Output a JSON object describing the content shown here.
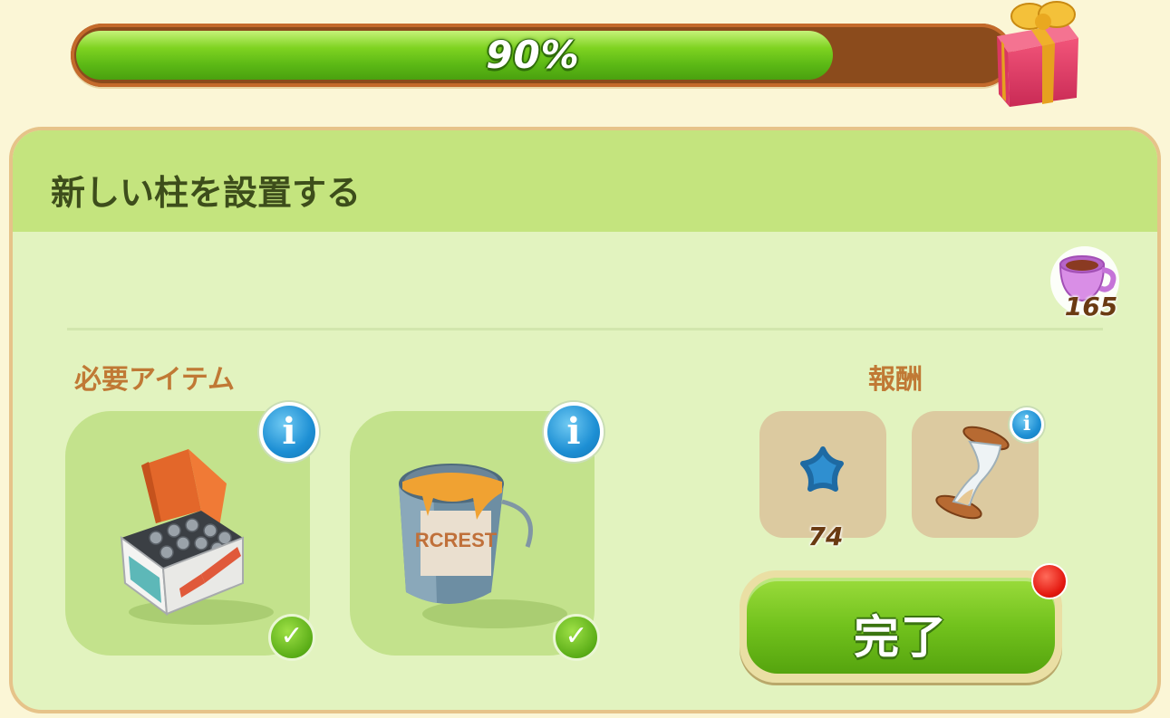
{
  "progress": {
    "percent_label": "90%",
    "value": 0.9
  },
  "gift": {
    "icon": "gift-box-icon"
  },
  "task": {
    "title": "新しい柱を設置する",
    "cost_icon": "teacup-icon",
    "cost_count": "165"
  },
  "required": {
    "label": "必要アイテム",
    "items": [
      {
        "icon": "box-of-screws-icon",
        "info": "i",
        "done": "✓"
      },
      {
        "icon": "paint-can-icon",
        "info": "i",
        "done": "✓"
      }
    ]
  },
  "rewards": {
    "label": "報酬",
    "items": [
      {
        "icon": "blue-star-icon",
        "count": "74"
      },
      {
        "icon": "hourglass-icon",
        "info": "i"
      }
    ]
  },
  "complete_button": {
    "label": "完了"
  }
}
